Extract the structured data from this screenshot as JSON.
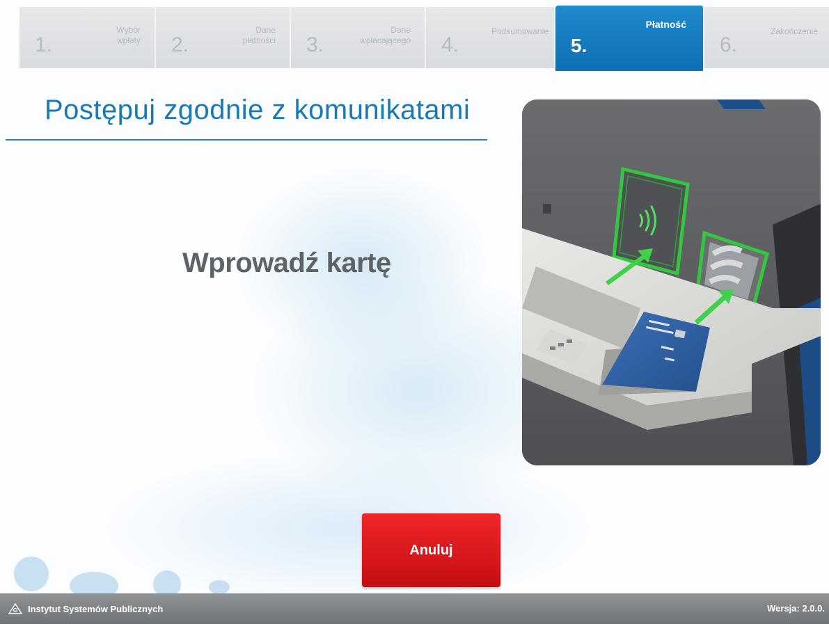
{
  "steps": [
    {
      "num": "1.",
      "label": "Wybór\nwpłaty",
      "state": "inactive"
    },
    {
      "num": "2.",
      "label": "Dane\npłatności",
      "state": "inactive"
    },
    {
      "num": "3.",
      "label": "Dane\nwpłacającego",
      "state": "inactive"
    },
    {
      "num": "4.",
      "label": "Podsumowanie",
      "state": "inactive"
    },
    {
      "num": "5.",
      "label": "Płatność",
      "state": "active"
    },
    {
      "num": "6.",
      "label": "Zakończenie",
      "state": "inactive"
    }
  ],
  "page": {
    "title": "Postępuj zgodnie z komunikatami",
    "prompt": "Wprowadź kartę"
  },
  "illustration": {
    "icon": "card-reader-illustration",
    "contactless_icon": "contactless-icon"
  },
  "actions": {
    "cancel_label": "Anuluj"
  },
  "footer": {
    "brand": "Instytut Systemów Publicznych",
    "version": "Wersja: 2.0.0."
  },
  "colors": {
    "accent": "#1f8bd0",
    "cancel": "#e0171b",
    "highlight": "#3fd14a"
  }
}
